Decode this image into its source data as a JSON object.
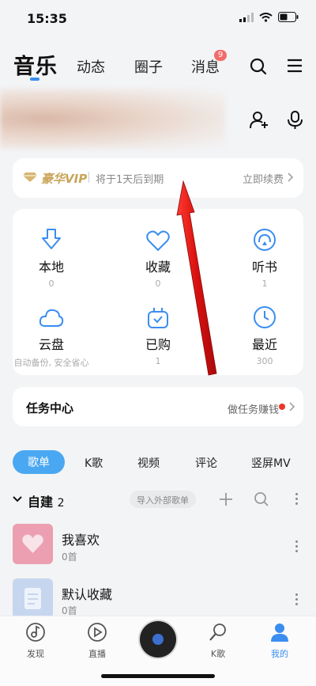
{
  "status": {
    "time": "15:35"
  },
  "nav": {
    "tabs": [
      "音乐",
      "动态",
      "圈子",
      "消息"
    ],
    "badge": "9"
  },
  "vip": {
    "label": "豪华VIP",
    "expire": "将于1天后到期",
    "renew": "立即续费"
  },
  "grid": [
    {
      "label": "本地",
      "sub": "0",
      "icon": "download-icon"
    },
    {
      "label": "收藏",
      "sub": "0",
      "icon": "heart-icon"
    },
    {
      "label": "听书",
      "sub": "1",
      "icon": "headphone-icon"
    },
    {
      "label": "云盘",
      "sub": "自动备份, 安全省心",
      "icon": "cloud-icon"
    },
    {
      "label": "已购",
      "sub": "1",
      "icon": "bag-icon"
    },
    {
      "label": "最近",
      "sub": "300",
      "icon": "clock-icon"
    }
  ],
  "task": {
    "title": "任务中心",
    "earn": "做任务赚钱"
  },
  "filters": [
    "歌单",
    "K歌",
    "视频",
    "评论",
    "竖屏MV"
  ],
  "created": {
    "title": "自建",
    "count": "2",
    "import": "导入外部歌单"
  },
  "playlists": [
    {
      "name": "我喜欢",
      "count": "0首"
    },
    {
      "name": "默认收藏",
      "count": "0首"
    }
  ],
  "bottom_nav": [
    "发现",
    "直播",
    "K歌",
    "我的"
  ],
  "colors": {
    "accent": "#3b8df0",
    "vip_gold": "#c9a55a",
    "arrow": "#e0141a"
  }
}
